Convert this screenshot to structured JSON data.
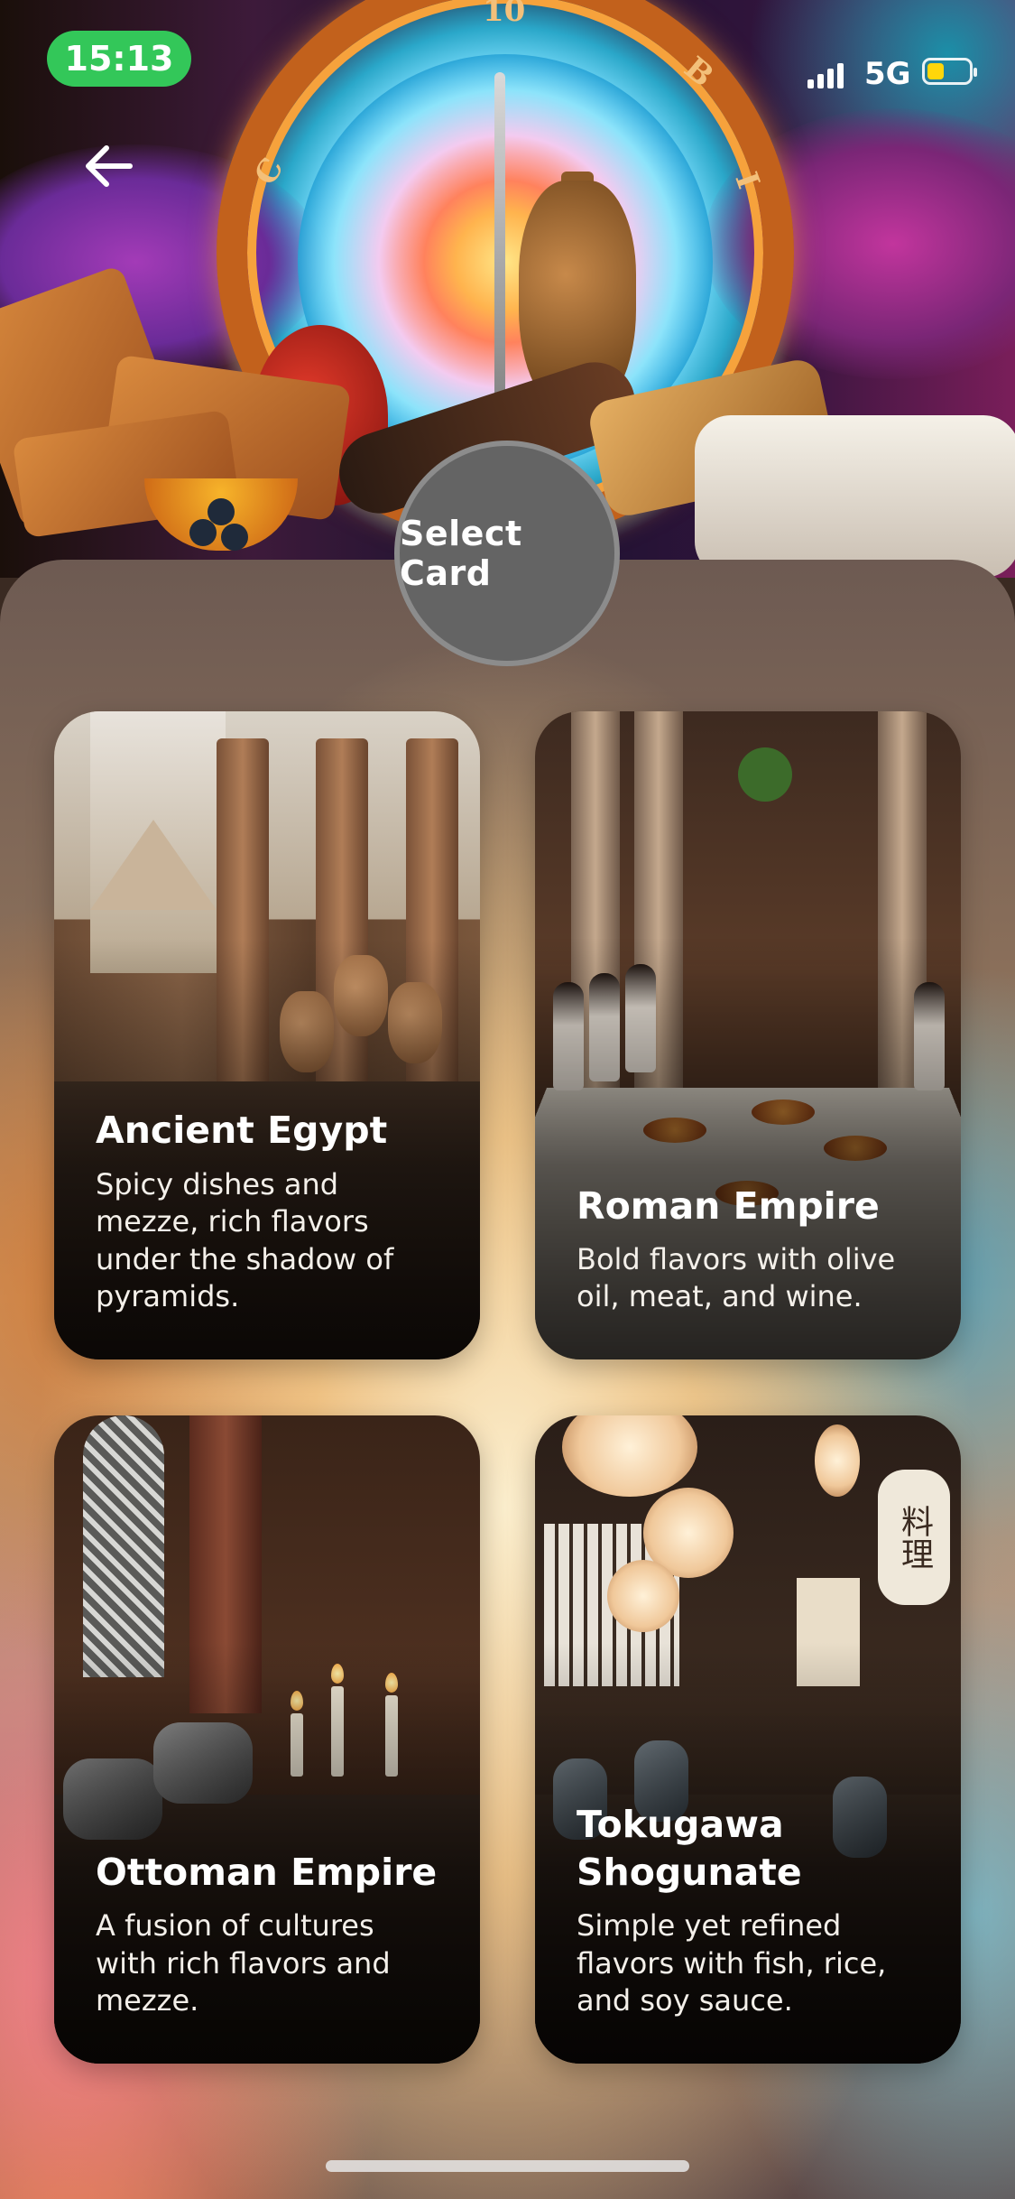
{
  "status_bar": {
    "time": "15:13",
    "network": "5G",
    "battery_level": 0.4,
    "colors": {
      "time_pill": "#33c759",
      "battery": "#ffd60a"
    }
  },
  "hero": {
    "back_icon": "arrow-left-icon",
    "select_label": "Select Card"
  },
  "cards": [
    {
      "title": "Ancient Egypt",
      "description": "Spicy dishes and mezze, rich flavors under the shadow of pyramids."
    },
    {
      "title": "Roman Empire",
      "description": "Bold flavors with olive oil, meat, and wine."
    },
    {
      "title": "Ottoman Empire",
      "description": "A fusion of cultures with rich flavors and mezze."
    },
    {
      "title": "Tokugawa Shogunate",
      "description": "Simple yet refined flavors with fish, rice, and soy sauce."
    }
  ]
}
